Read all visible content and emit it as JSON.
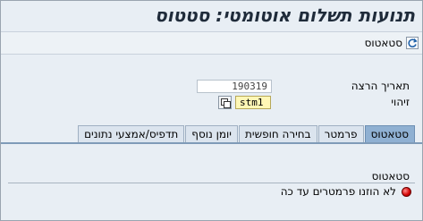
{
  "window": {
    "title": "תנועות תשלום אוטומטי: סטטוס"
  },
  "toolbar": {
    "status_button_label": "סטאטוס"
  },
  "form": {
    "run_date_label": "תאריך הרצה",
    "run_date_value": "190319",
    "id_label": "זיהוי",
    "id_value": "stm1"
  },
  "tabs": [
    {
      "label": "סטאטוס",
      "active": true
    },
    {
      "label": "פרמטר",
      "active": false
    },
    {
      "label": "בחירה חופשית",
      "active": false
    },
    {
      "label": "יומן נוסף",
      "active": false
    },
    {
      "label": "תדפיס/אמצעי נתונים",
      "active": false
    }
  ],
  "status_panel": {
    "title": "סטאטוס",
    "message": "לא הוזנו פרמטרים עד כה",
    "light_color": "#d20000"
  }
}
